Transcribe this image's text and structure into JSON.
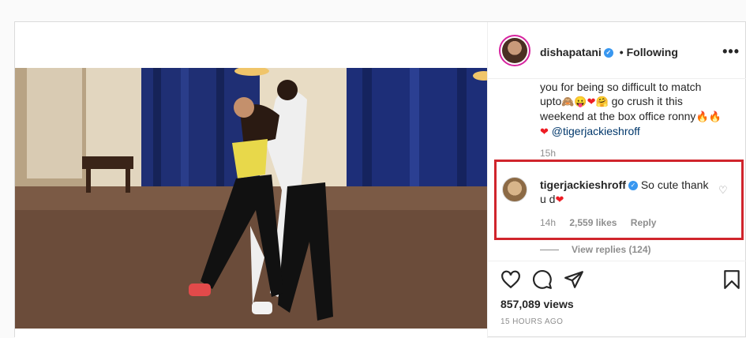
{
  "header": {
    "username": "dishapatani",
    "separator": "•",
    "follow_status": "Following",
    "more_label": "•••"
  },
  "caption": {
    "line1": "you for being so difficult to match",
    "line2_start": "upto",
    "line2_end": "go crush it this",
    "line3": "weekend at the box office ronny",
    "mention": "@tigerjackieshroff",
    "time": "15h"
  },
  "comment": {
    "username": "tigerjackieshroff",
    "text_start": "So cute thank",
    "text_end": "u d",
    "time": "14h",
    "likes": "2,559 likes",
    "reply_label": "Reply",
    "view_replies": "View replies (124)"
  },
  "stats": {
    "views": "857,089 views",
    "posted": "15 HOURS AGO"
  },
  "icons": [
    "heart-icon",
    "comment-icon",
    "share-icon",
    "bookmark-icon",
    "verified-icon",
    "more-icon"
  ],
  "colors": {
    "highlight_border": "#d0252c",
    "verified": "#3897f0",
    "mention": "#00376b",
    "heart": "#ed1c24"
  }
}
